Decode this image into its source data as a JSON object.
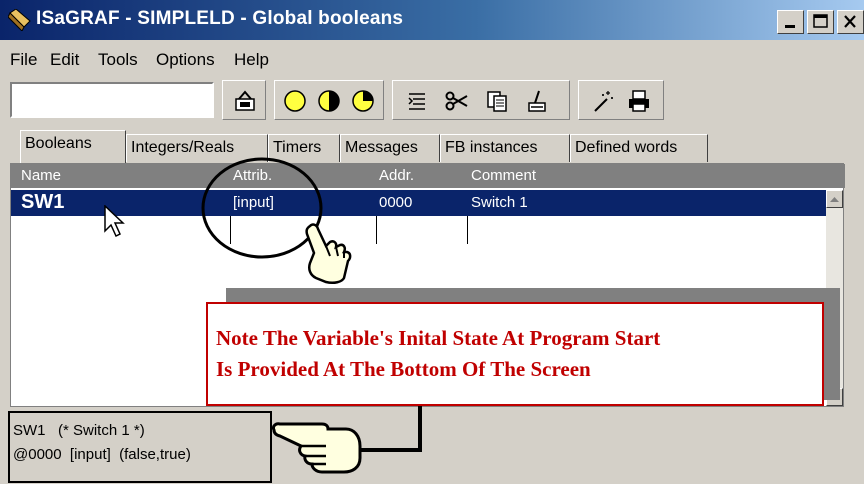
{
  "window": {
    "title": "ISaGRAF - SIMPLELD - Global booleans"
  },
  "menu": {
    "items": [
      "File",
      "Edit",
      "Tools",
      "Options",
      "Help"
    ]
  },
  "toolbar": {
    "input_value": "",
    "icons": [
      "open-icon",
      "yellow-circle-icon",
      "half-circle-icon",
      "clock-circle-icon",
      "list-icon",
      "scissors-icon",
      "copy-icon",
      "paste-icon",
      "wand-icon",
      "print-icon"
    ]
  },
  "tabs": [
    "Booleans",
    "Integers/Reals",
    "Timers",
    "Messages",
    "FB instances",
    "Defined words"
  ],
  "active_tab": "Booleans",
  "grid": {
    "columns": [
      "Name",
      "Attrib.",
      "Addr.",
      "Comment"
    ],
    "rows": [
      {
        "name": "SW1",
        "attrib": "[input]",
        "addr": "0000",
        "comment": "Switch 1"
      }
    ]
  },
  "note": {
    "line1": "Note The Variable's Inital State At Program Start",
    "line2": "Is Provided At The Bottom Of The Screen"
  },
  "status": {
    "line1": "SW1   (* Switch 1 *)",
    "line2": "@0000  [input]  (false,true)"
  },
  "colors": {
    "title_start": "#0a246a",
    "title_end": "#a6caf0",
    "selection": "#0a246a",
    "note_text": "#c00000",
    "face": "#d4d0c8"
  }
}
